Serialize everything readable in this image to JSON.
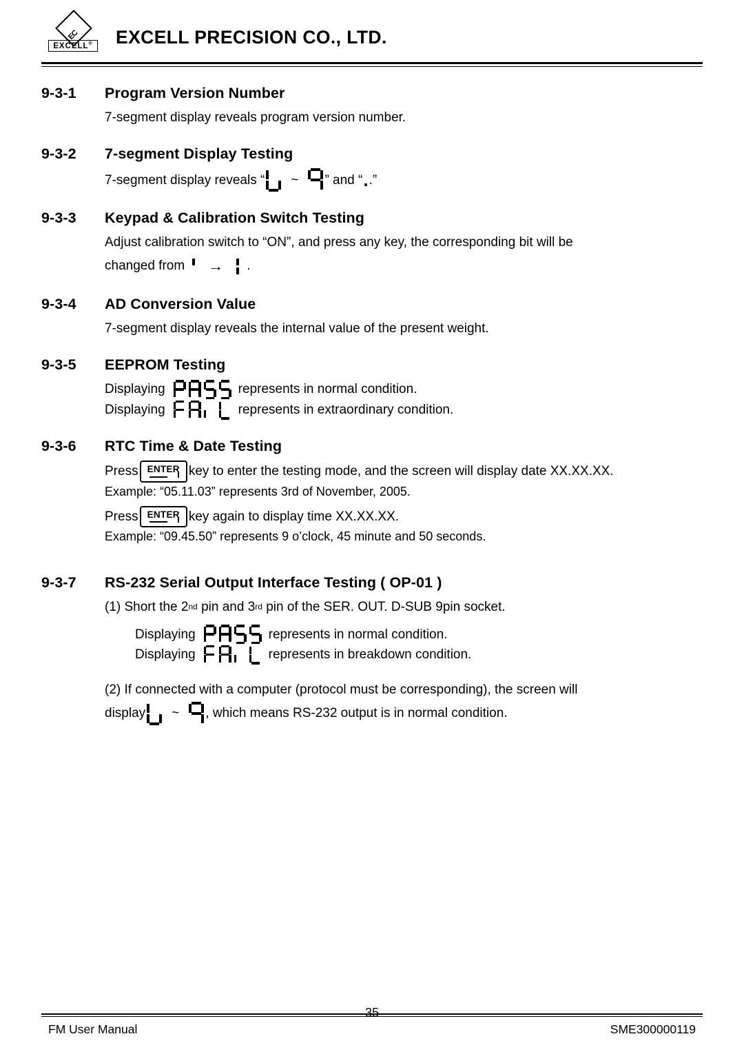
{
  "header": {
    "logo_mark": "EC",
    "logo_word": "EXCELL",
    "logo_word_sup": "®",
    "company": "EXCELL PRECISION CO., LTD."
  },
  "sections": [
    {
      "number": "9-3-1",
      "title": "Program Version Number",
      "lines": [
        "7-segment display reveals program version number."
      ]
    },
    {
      "number": "9-3-2",
      "title": "7-segment Display Testing",
      "lead": "7-segment display reveals “",
      "tilde": "~",
      "mid": "” and “",
      "tail": ".”"
    },
    {
      "number": "9-3-3",
      "title": "Keypad & Calibration Switch Testing",
      "lines": [
        "Adjust calibration switch to “ON”, and press any key, the corresponding bit will be",
        "changed from"
      ],
      "arrow": "→",
      "period": "."
    },
    {
      "number": "9-3-4",
      "title": "AD Conversion Value",
      "lines": [
        "7-segment display reveals the internal value of the present weight."
      ]
    },
    {
      "number": "9-3-5",
      "title": "EEPROM Testing",
      "line1_pre": "Displaying",
      "line1_post": "represents in normal condition.",
      "line1_glyphs": "PASS",
      "line2_pre": "Displaying",
      "line2_post": "represents in extraordinary condition.",
      "line2_glyphs": "FAIL"
    },
    {
      "number": "9-3-6",
      "title": "RTC Time & Date Testing",
      "press1_pre": "Press",
      "enter_label": "ENTER",
      "press1_post": "key to enter the testing mode, and the screen will display date XX.XX.XX.",
      "example1": "Example: “05.11.03” represents 3rd of November, 2005.",
      "press2_pre": "Press",
      "press2_post": "key again to display time XX.XX.XX.",
      "example2": "Example: “09.45.50” represents 9 o’clock, 45 minute and 50 seconds."
    },
    {
      "number": "9-3-7",
      "title": "RS-232 Serial Output Interface Testing ( OP-01 )",
      "item1_pre": "(1) Short the 2",
      "item1_sup1": "nd",
      "item1_mid": "pin and 3",
      "item1_sup2": "rd",
      "item1_post": "pin of the SER. OUT. D-SUB 9pin socket.",
      "disp1_pre": "Displaying",
      "disp1_post": "represents in normal condition.",
      "disp1_glyphs": "PASS",
      "disp2_pre": "Displaying",
      "disp2_post": "represents in breakdown condition.",
      "disp2_glyphs": "FAIL",
      "item2_line1": "(2) If connected with a computer (protocol must be corresponding), the screen will",
      "item2_pre": "display",
      "item2_tilde": "~",
      "item2_post": ", which means RS-232 output is in normal condition."
    }
  ],
  "footer": {
    "page_number": "35",
    "left": "FM User Manual",
    "center": "",
    "right": "SME300000119"
  }
}
